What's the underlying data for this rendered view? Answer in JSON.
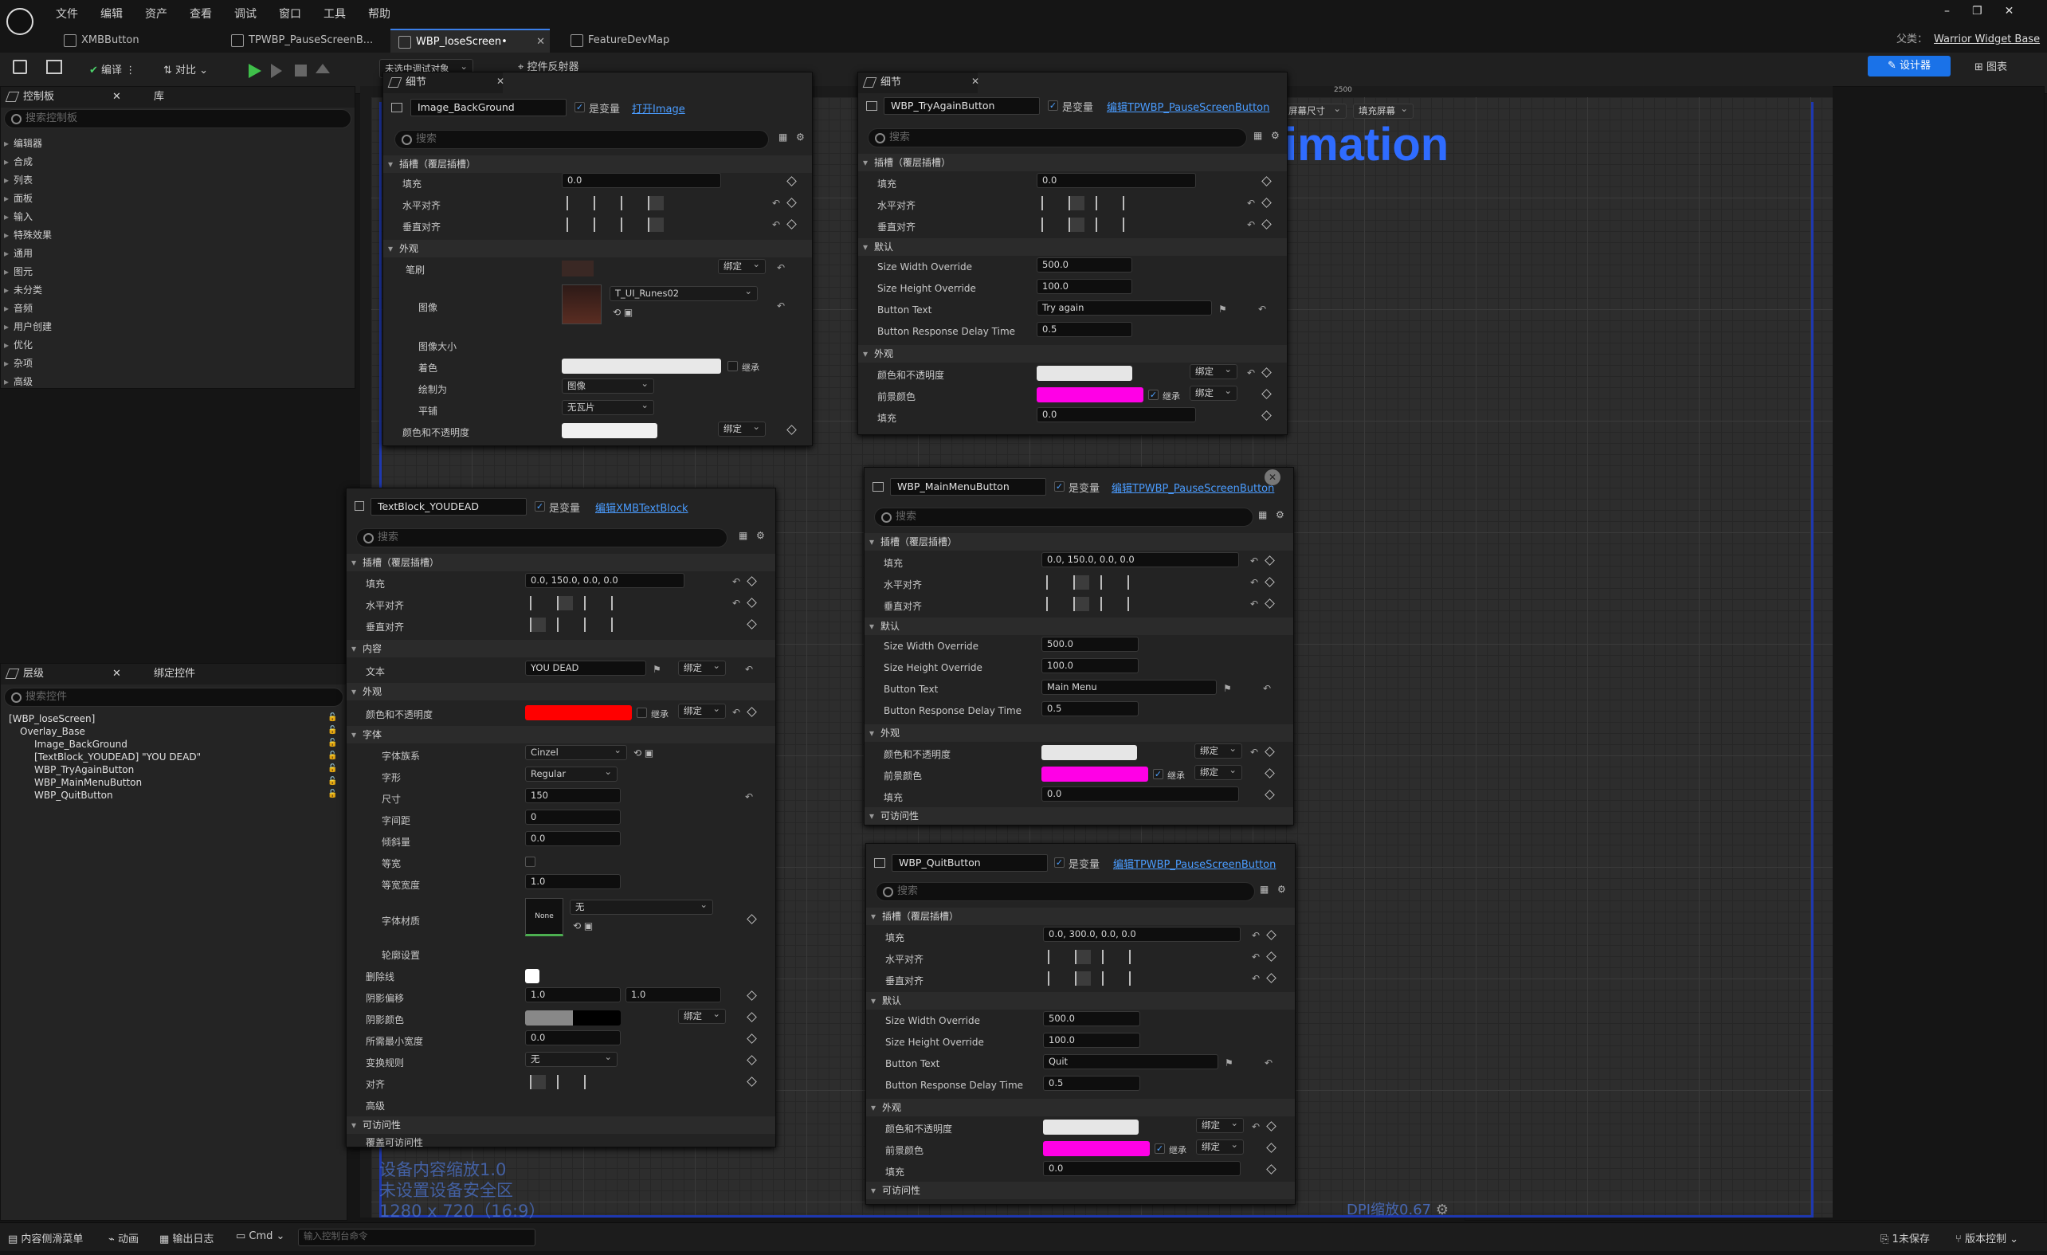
{
  "menu": [
    "文件",
    "编辑",
    "资产",
    "查看",
    "调试",
    "窗口",
    "工具",
    "帮助"
  ],
  "tabs": [
    {
      "label": "XMBButton",
      "active": false
    },
    {
      "label": "TPWBP_PauseScreenB...",
      "active": false
    },
    {
      "label": "WBP_loseScreen•",
      "active": true
    },
    {
      "label": "FeatureDevMap",
      "active": false
    }
  ],
  "parent": {
    "prefix": "父类：",
    "name": "Warrior Widget Base"
  },
  "toolbar": {
    "compile": "编译",
    "diff": "对比",
    "debug_target": "未选中调试对象",
    "reflector": "控件反射器",
    "designer": "设计器",
    "graph": "图表"
  },
  "palette": {
    "title": "控制板",
    "library": "库",
    "search": "搜索控制板",
    "items": [
      "编辑器",
      "合成",
      "列表",
      "面板",
      "输入",
      "特殊效果",
      "通用",
      "图元",
      "未分类",
      "音频",
      "用户创建",
      "优化",
      "杂项",
      "高级"
    ]
  },
  "hierarchy": {
    "title": "层级",
    "bind": "绑定控件",
    "search": "搜索控件",
    "items": [
      "[WBP_loseScreen]",
      "Overlay_Base",
      "Image_BackGround",
      "[TextBlock_YOUDEAD] \"YOU DEAD\"",
      "WBP_TryAgainButton",
      "WBP_MainMenuButton",
      "WBP_QuitButton"
    ]
  },
  "right_details": {
    "title": "细节"
  },
  "canvas": {
    "ruler_mark": "2500",
    "screen_size": "屏幕尺寸",
    "fill_screen": "填充屏幕",
    "bg_title": "imation",
    "overlay_lines": [
      "设备内容缩放1.0",
      "未设置设备安全区",
      "1280 x 720（16:9）"
    ],
    "dpi": "DPI缩放0.67"
  },
  "common": {
    "is_var": "是变量",
    "search": "搜索",
    "slot": "插槽（覆层插槽）",
    "fill": "填充",
    "halign": "水平对齐",
    "valign": "垂直对齐",
    "appearance": "外观",
    "default": "默认",
    "bind": "绑定",
    "inherit": "继承",
    "accessibility": "可访问性",
    "color_opacity": "颜色和不透明度",
    "fg_color": "前景颜色",
    "details": "细节"
  },
  "d_image": {
    "name": "Image_BackGround",
    "link": "打开Image",
    "fill": "0.0",
    "brush": "笔刷",
    "image": "图像",
    "image_val": "T_UI_Runes02",
    "image_size": "图像大小",
    "tint": "着色",
    "draw_as": "绘制为",
    "draw_as_val": "图像",
    "tiling": "平铺",
    "tiling_val": "无瓦片",
    "extra": "可访问性"
  },
  "d_try": {
    "name": "WBP_TryAgainButton",
    "link": "编辑TPWBP_PauseScreenButton",
    "fill": "0.0",
    "w": "500.0",
    "h": "100.0",
    "text": "Try again",
    "delay": "0.5",
    "fill2": "0.0"
  },
  "d_main": {
    "name": "WBP_MainMenuButton",
    "link": "编辑TPWBP_PauseScreenButton",
    "fill": "0.0, 150.0, 0.0, 0.0",
    "w": "500.0",
    "h": "100.0",
    "text": "Main Menu",
    "delay": "0.5",
    "fill2": "0.0"
  },
  "d_quit": {
    "name": "WBP_QuitButton",
    "link": "编辑TPWBP_PauseScreenButton",
    "fill": "0.0, 300.0, 0.0, 0.0",
    "w": "500.0",
    "h": "100.0",
    "text": "Quit",
    "delay": "0.5",
    "fill2": "0.0"
  },
  "button_fields": {
    "w": "Size Width Override",
    "h": "Size Height Override",
    "text": "Button Text",
    "delay": "Button Response Delay Time"
  },
  "d_text": {
    "name": "TextBlock_YOUDEAD",
    "link": "编辑XMBTextBlock",
    "fill": "0.0, 150.0, 0.0, 0.0",
    "content": "内容",
    "text_lbl": "文本",
    "text": "YOU DEAD",
    "font": "字体",
    "family_lbl": "字体族系",
    "family": "Cinzel",
    "style_lbl": "字形",
    "style": "Regular",
    "size_lbl": "尺寸",
    "size": "150",
    "spacing_lbl": "字间距",
    "spacing": "0",
    "skew_lbl": "倾斜量",
    "skew": "0.0",
    "mono_lbl": "等宽",
    "mono_w_lbl": "等宽宽度",
    "mono_w": "1.0",
    "mat_lbl": "字体材质",
    "mat": "无",
    "none": "None",
    "outline": "轮廓设置",
    "strike": "删除线",
    "shadow_off": "阴影偏移",
    "sx": "1.0",
    "sy": "1.0",
    "shadow_col": "阴影颜色",
    "min_w": "所需最小宽度",
    "min_w_val": "0.0",
    "transform": "变换规则",
    "transform_val": "无",
    "justify": "对齐",
    "adv": "高级",
    "access": "可访问性",
    "access2": "覆盖可访问性"
  },
  "status": {
    "drawer": "内容侧滑菜单",
    "anim": "动画",
    "log": "输出日志",
    "cmd": "Cmd",
    "console": "输入控制台命令",
    "unsaved": "1未保存",
    "vcs": "版本控制"
  },
  "colors": {
    "accent": "#2f6cff",
    "magenta": "#ff00e6",
    "red": "#ff0000",
    "white": "#e8e8e8"
  }
}
